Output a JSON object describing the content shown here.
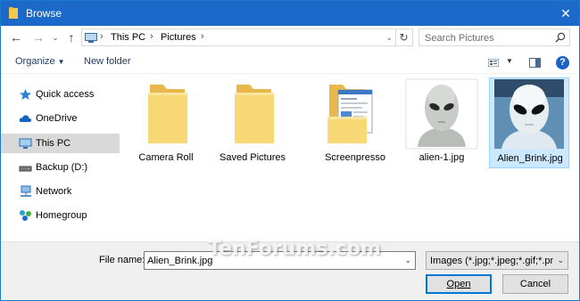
{
  "window": {
    "title": "Browse",
    "close_glyph": "✕"
  },
  "nav": {
    "back_glyph": "←",
    "forward_glyph": "→",
    "recent_glyph": "⌄",
    "up_glyph": "↑"
  },
  "address": {
    "crumbs": [
      "This PC",
      "Pictures"
    ],
    "separator": "›",
    "refresh_glyph": "↻",
    "dropdown_glyph": "⌄"
  },
  "search": {
    "placeholder": "Search Pictures"
  },
  "toolbar": {
    "organize_label": "Organize",
    "organize_caret": "▼",
    "new_folder_label": "New folder",
    "view_dropdown_glyph": "▼",
    "help_glyph": "?"
  },
  "sidebar": {
    "items": [
      {
        "label": "Quick access",
        "icon": "star-icon"
      },
      {
        "label": "OneDrive",
        "icon": "cloud-icon"
      },
      {
        "label": "This PC",
        "icon": "computer-icon",
        "selected": true
      },
      {
        "label": "Backup (D:)",
        "icon": "drive-icon"
      },
      {
        "label": "Network",
        "icon": "network-icon"
      },
      {
        "label": "Homegroup",
        "icon": "homegroup-icon"
      }
    ]
  },
  "files": [
    {
      "name": "Camera Roll",
      "type": "folder"
    },
    {
      "name": "Saved Pictures",
      "type": "folder"
    },
    {
      "name": "Screenpresso",
      "type": "folder"
    },
    {
      "name": "alien-1.jpg",
      "type": "image"
    },
    {
      "name": "Alien_Brink.jpg",
      "type": "image",
      "selected": true
    }
  ],
  "footer": {
    "file_name_label": "File name:",
    "file_name_value": "Alien_Brink.jpg",
    "file_type_value": "Images (*.jpg;*.jpeg;*.gif;*.png;",
    "dropdown_glyph": "⌄",
    "open_label": "Open",
    "cancel_label": "Cancel"
  },
  "watermark": "TenForums.com",
  "colors": {
    "titlebar": "#1b6ac9",
    "selection": "#cce8ff",
    "accent": "#0078d7",
    "folder": "#f5d36b"
  }
}
